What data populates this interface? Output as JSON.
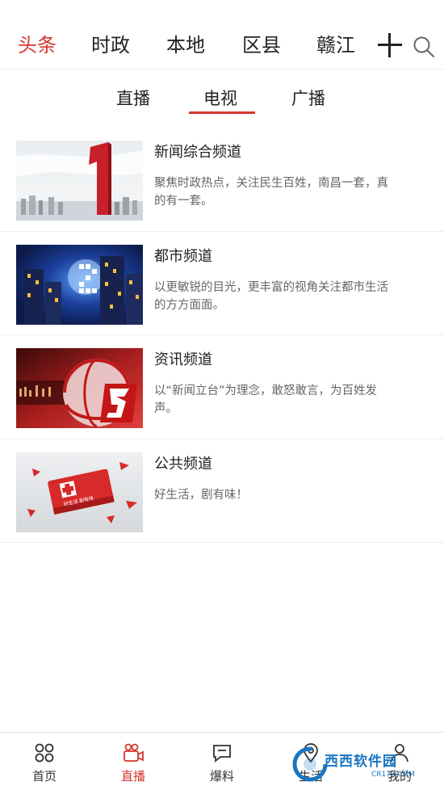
{
  "topnav": {
    "tabs": [
      {
        "label": "头条",
        "active": true
      },
      {
        "label": "时政",
        "active": false
      },
      {
        "label": "本地",
        "active": false
      },
      {
        "label": "区县",
        "active": false
      },
      {
        "label": "赣江",
        "active": false
      }
    ],
    "add_icon": "plus-icon",
    "search_icon": "search-icon"
  },
  "subtabs": {
    "items": [
      {
        "label": "直播",
        "active": false
      },
      {
        "label": "电视",
        "active": true
      },
      {
        "label": "广播",
        "active": false
      }
    ]
  },
  "channels": [
    {
      "title": "新闻综合频道",
      "desc": "聚焦时政热点，关注民生百姓，南昌一套，真的有一套。",
      "thumb_badge": "1"
    },
    {
      "title": "都市频道",
      "desc": "以更敏锐的目光，更丰富的视角关注都市生活的方方面面。",
      "thumb_badge": "2"
    },
    {
      "title": "资讯频道",
      "desc": "以“新闻立台”为理念，敢怒敢言，为百姓发声。",
      "thumb_badge": "3"
    },
    {
      "title": "公共频道",
      "desc": "好生活，剧有味！",
      "thumb_badge": "好生活 剧有味"
    }
  ],
  "tabbar": {
    "items": [
      {
        "label": "首页",
        "icon": "grid-icon",
        "active": false
      },
      {
        "label": "直播",
        "icon": "video-camera-icon",
        "active": true
      },
      {
        "label": "爆料",
        "icon": "chat-bubble-icon",
        "active": false
      },
      {
        "label": "生活",
        "icon": "location-icon",
        "active": false
      },
      {
        "label": "我的",
        "icon": "user-icon",
        "active": false
      }
    ]
  },
  "watermark": {
    "text": "西西软件园",
    "sub": "CR173.COM"
  },
  "colors": {
    "accent": "#d6362f",
    "text": "#222222",
    "muted": "#666666",
    "divider": "#ededed"
  }
}
